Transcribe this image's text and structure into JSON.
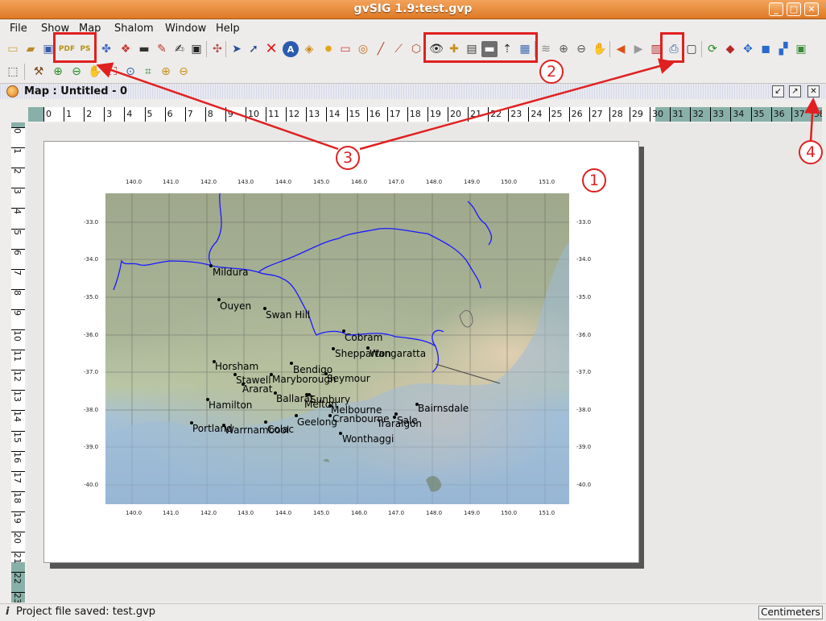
{
  "window": {
    "title": "gvSIG 1.9:test.gvp"
  },
  "menu": [
    "File",
    "Show",
    "Map",
    "Shalom",
    "Window",
    "Help"
  ],
  "frame": {
    "title": "Map : Untitled - 0"
  },
  "ruler": {
    "h": [
      "0",
      "1",
      "2",
      "3",
      "4",
      "5",
      "6",
      "7",
      "8",
      "9",
      "10",
      "11",
      "12",
      "13",
      "14",
      "15",
      "16",
      "17",
      "18",
      "19",
      "20",
      "21",
      "22",
      "23",
      "24",
      "25",
      "26",
      "27",
      "28",
      "29",
      "30",
      "31",
      "32",
      "33",
      "34",
      "35",
      "36",
      "37",
      "38"
    ],
    "v": [
      "0",
      "1",
      "2",
      "3",
      "4",
      "5",
      "6",
      "7",
      "8",
      "9",
      "10",
      "11",
      "12",
      "13",
      "14",
      "15",
      "16",
      "17",
      "18",
      "19",
      "20",
      "21",
      "22",
      "23"
    ]
  },
  "map": {
    "lon_ticks": [
      "140.0",
      "141.0",
      "142.0",
      "143.0",
      "144.0",
      "145.0",
      "146.0",
      "147.0",
      "148.0",
      "149.0",
      "150.0",
      "151.0"
    ],
    "lat_ticks": [
      "-33.0",
      "-34.0",
      "-35.0",
      "-36.0",
      "-37.0",
      "-38.0",
      "-39.0",
      "-40.0"
    ],
    "cities": [
      "Mildura",
      "Ouyen",
      "Swan Hill",
      "Cobram",
      "Shepparton",
      "Wangaratta",
      "Horsham",
      "Bendigo",
      "Stawell",
      "Maryborough",
      "Seymour",
      "Ararat",
      "Ballarat",
      "Sunbury",
      "Melton",
      "Hamilton",
      "Melbourne",
      "Bairnsdale",
      "Cranbourne",
      "Sale",
      "Traralgon",
      "Geelong",
      "Portland",
      "Warrnambool",
      "Colac",
      "Wonthaggi"
    ]
  },
  "annotations": [
    "1",
    "2",
    "3",
    "4"
  ],
  "status": {
    "message": "Project file saved: test.gvp",
    "units": "Centimeters"
  },
  "colors": {
    "annotation": "#e02020",
    "title_bar": "#e38a3c",
    "river": "#1a1aff"
  }
}
